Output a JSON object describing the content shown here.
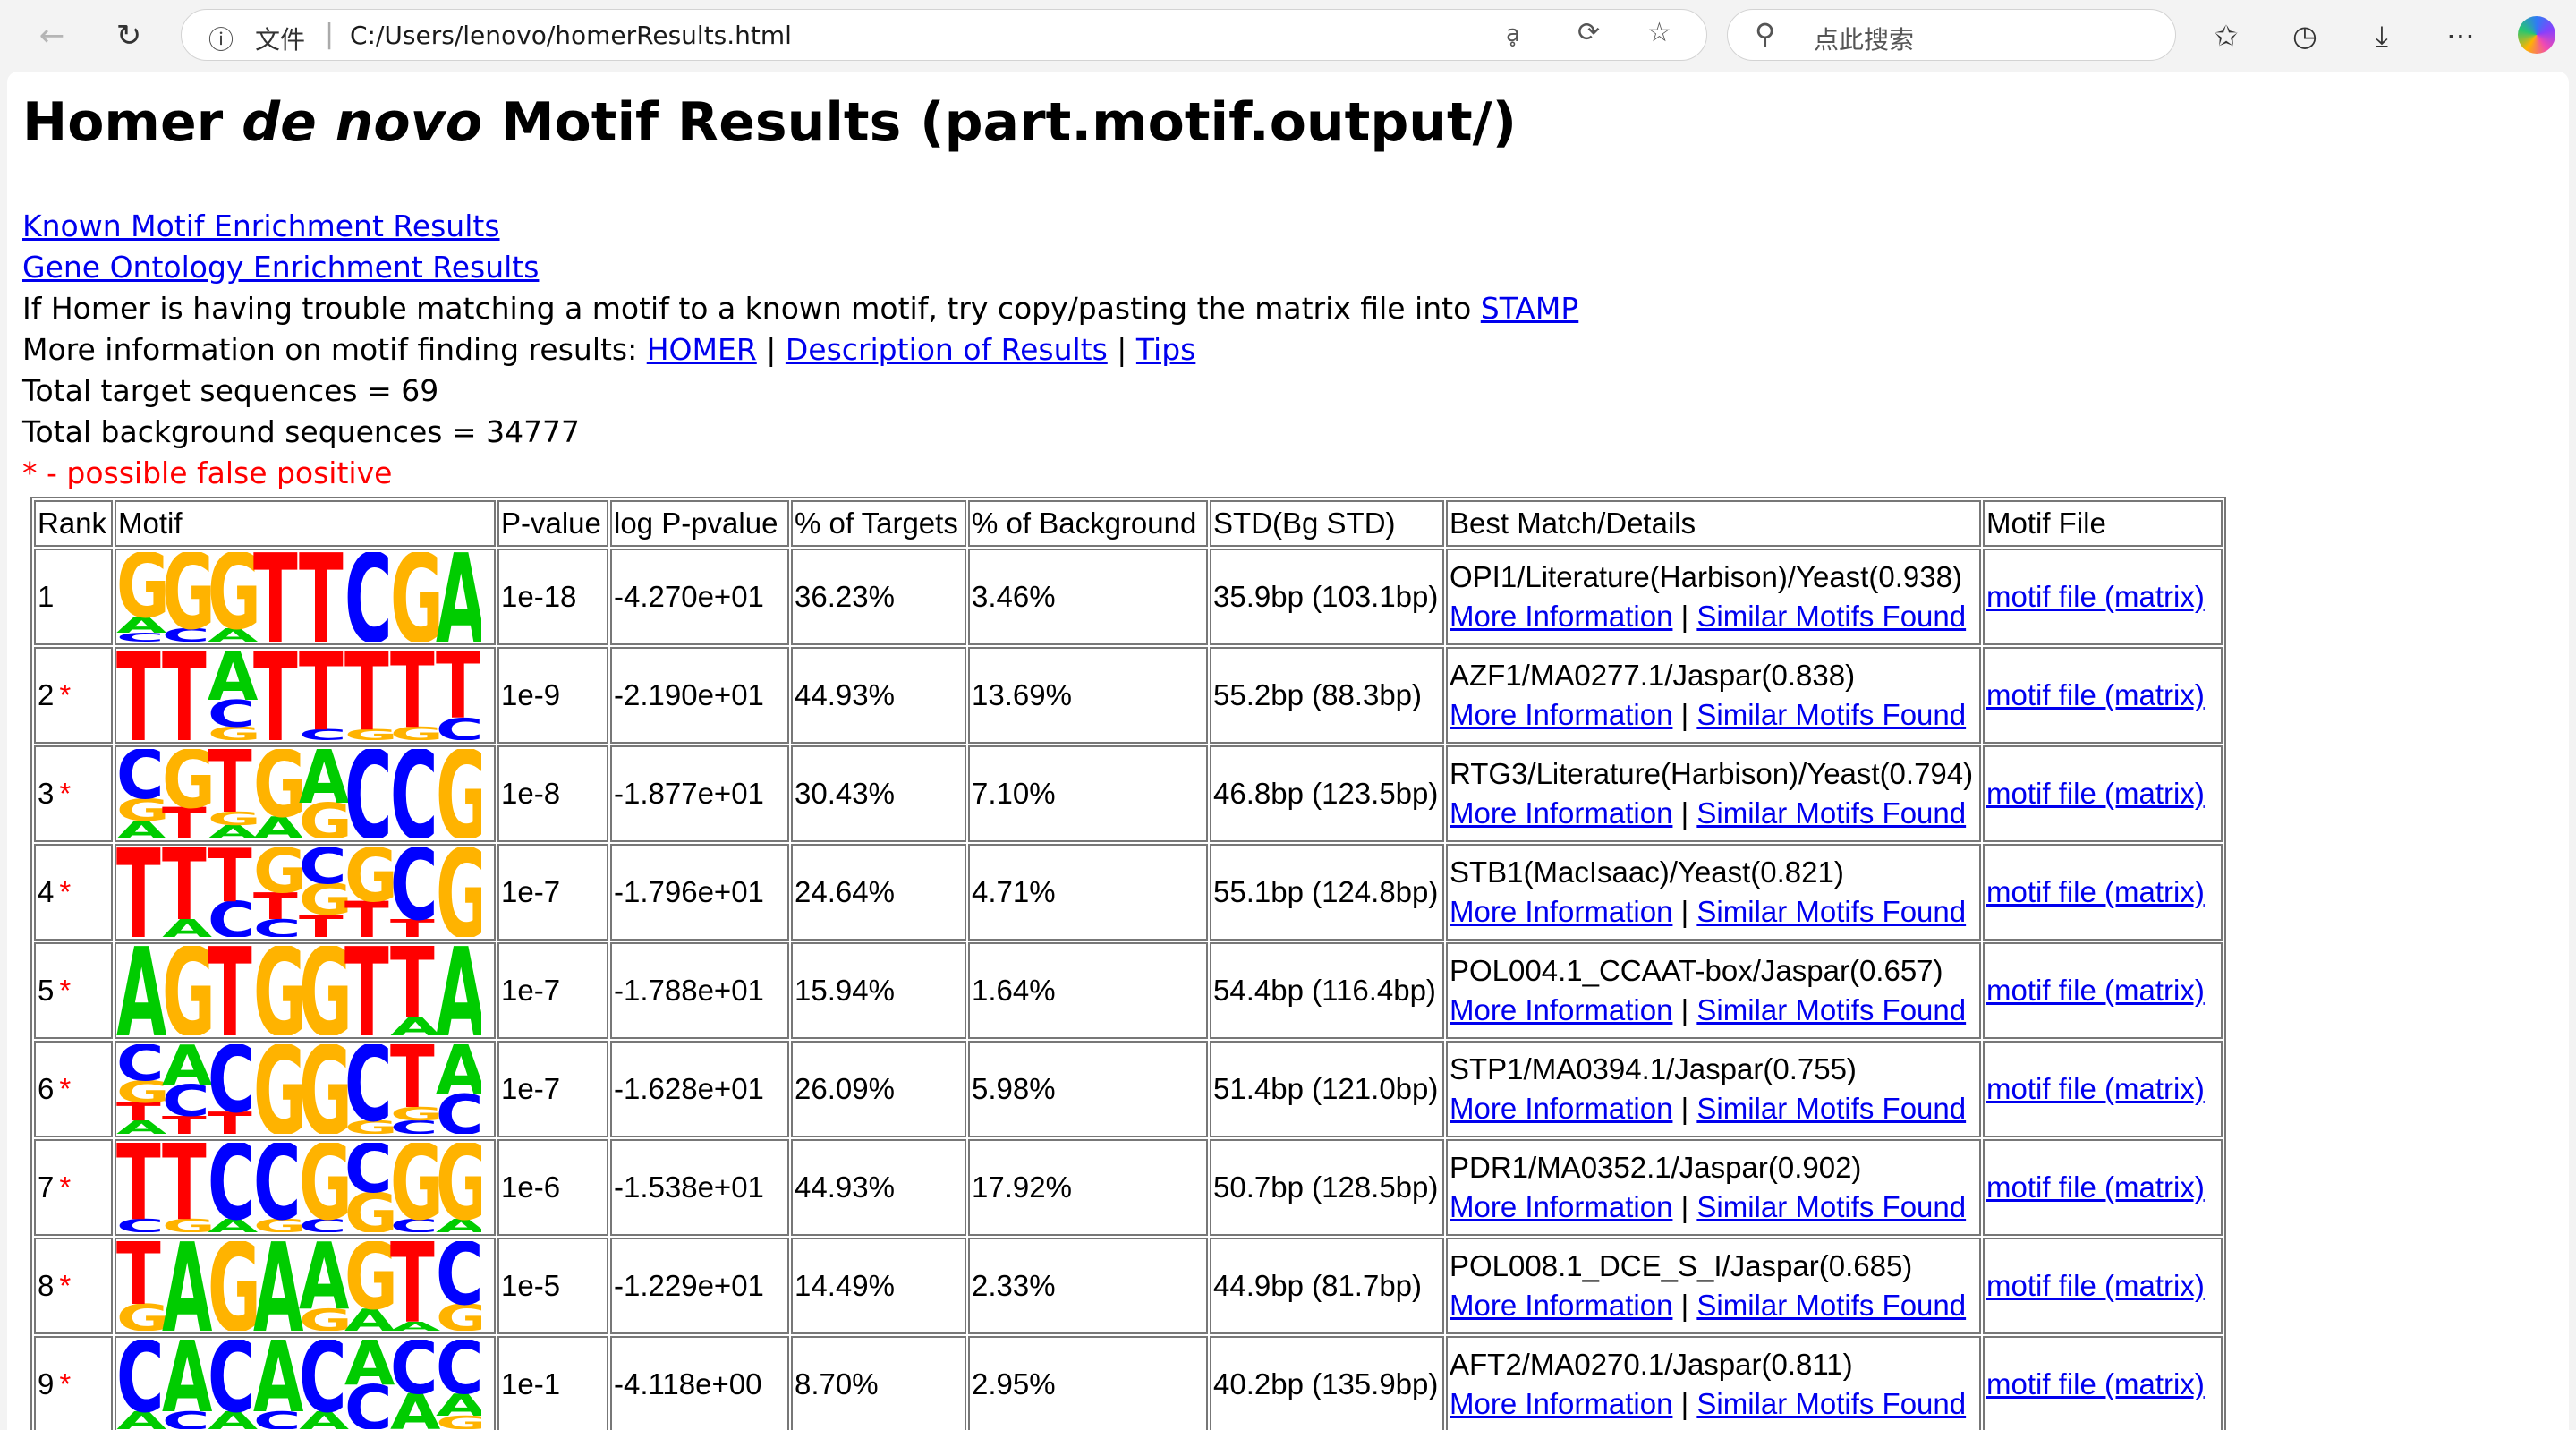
{
  "browser": {
    "address": {
      "info_icon": "info-icon",
      "file_label": "文件",
      "url": "C:/Users/lenovo/homerResults.html"
    },
    "search": {
      "placeholder": "点此搜索"
    },
    "icons": {
      "back": "back-arrow-icon",
      "refresh": "refresh-icon",
      "read_aloud": "read-aloud-icon",
      "extensions": "extensions-icon",
      "favorite": "star-icon",
      "favorites": "favorites-icon",
      "history": "history-icon",
      "downloads": "download-icon",
      "more": "more-icon",
      "copilot": "copilot-icon"
    }
  },
  "page": {
    "title_prefix": "Homer ",
    "title_italic": "de novo",
    "title_suffix": " Motif Results (part.motif.output/)",
    "link_known": "Known Motif Enrichment Results",
    "link_go": "Gene Ontology Enrichment Results",
    "stamp_text": "If Homer is having trouble matching a motif to a known motif, try copy/pasting the matrix file into ",
    "stamp_link": "STAMP",
    "more_info_text": "More information on motif finding results: ",
    "link_homer": "HOMER",
    "link_description": "Description of Results",
    "link_tips": "Tips",
    "separator": " | ",
    "total_target": "Total target sequences = 69",
    "total_background": "Total background sequences = 34777",
    "false_positive_note": "* - possible false positive"
  },
  "colors": {
    "A": "#00cc00",
    "C": "#0000ff",
    "G": "#ffb300",
    "T": "#ff0000",
    "link": "#0000ee",
    "warning": "#ff0000"
  },
  "table": {
    "headers": [
      "Rank",
      "Motif",
      "P-value",
      "log P-pvalue",
      "% of Targets",
      "% of Background",
      "STD(Bg STD)",
      "Best Match/Details",
      "Motif File"
    ],
    "more_info_label": "More Information",
    "similar_label": "Similar Motifs Found",
    "motif_file_label": "motif file (matrix)",
    "rows": [
      {
        "rank": "1",
        "star": "",
        "pvalue": "1e-18",
        "logp": "-4.270e+01",
        "targets": "36.23%",
        "background": "3.46%",
        "std": "35.9bp (103.1bp)",
        "match": "OPI1/Literature(Harbison)/Yeast(0.938)",
        "logo": [
          [
            {
              "b": "G",
              "h": 0.72
            },
            {
              "b": "C",
              "h": 0.1
            },
            {
              "b": "A",
              "h": 0.18
            }
          ],
          [
            {
              "b": "G",
              "h": 0.85
            },
            {
              "b": "C",
              "h": 0.15
            }
          ],
          [
            {
              "b": "G",
              "h": 0.85
            },
            {
              "b": "A",
              "h": 0.15
            }
          ],
          [
            {
              "b": "T",
              "h": 1.0
            }
          ],
          [
            {
              "b": "T",
              "h": 1.0
            }
          ],
          [
            {
              "b": "C",
              "h": 1.0
            }
          ],
          [
            {
              "b": "G",
              "h": 1.0
            }
          ],
          [
            {
              "b": "A",
              "h": 1.0
            }
          ]
        ]
      },
      {
        "rank": "2",
        "star": "*",
        "pvalue": "1e-9",
        "logp": "-2.190e+01",
        "targets": "44.93%",
        "background": "13.69%",
        "std": "55.2bp (88.3bp)",
        "match": "AZF1/MA0277.1/Jaspar(0.838)",
        "logo": [
          [
            {
              "b": "T",
              "h": 1.0
            }
          ],
          [
            {
              "b": "T",
              "h": 1.0
            }
          ],
          [
            {
              "b": "A",
              "h": 0.55
            },
            {
              "b": "C",
              "h": 0.3
            },
            {
              "b": "G",
              "h": 0.15
            }
          ],
          [
            {
              "b": "T",
              "h": 1.0
            }
          ],
          [
            {
              "b": "T",
              "h": 0.88
            },
            {
              "b": "C",
              "h": 0.12
            }
          ],
          [
            {
              "b": "T",
              "h": 0.88
            },
            {
              "b": "G",
              "h": 0.12
            }
          ],
          [
            {
              "b": "T",
              "h": 0.85
            },
            {
              "b": "G",
              "h": 0.15
            }
          ],
          [
            {
              "b": "T",
              "h": 0.75
            },
            {
              "b": "C",
              "h": 0.25
            }
          ]
        ]
      },
      {
        "rank": "3",
        "star": "*",
        "pvalue": "1e-8",
        "logp": "-1.877e+01",
        "targets": "30.43%",
        "background": "7.10%",
        "std": "46.8bp (123.5bp)",
        "match": "RTG3/Literature(Harbison)/Yeast(0.794)",
        "logo": [
          [
            {
              "b": "C",
              "h": 0.55
            },
            {
              "b": "G",
              "h": 0.25
            },
            {
              "b": "A",
              "h": 0.2
            }
          ],
          [
            {
              "b": "G",
              "h": 0.65
            },
            {
              "b": "T",
              "h": 0.35
            }
          ],
          [
            {
              "b": "T",
              "h": 0.7
            },
            {
              "b": "A",
              "h": 0.15
            },
            {
              "b": "G",
              "h": 0.15
            }
          ],
          [
            {
              "b": "G",
              "h": 0.75
            },
            {
              "b": "A",
              "h": 0.25
            }
          ],
          [
            {
              "b": "A",
              "h": 0.6
            },
            {
              "b": "G",
              "h": 0.4
            }
          ],
          [
            {
              "b": "C",
              "h": 1.0
            }
          ],
          [
            {
              "b": "C",
              "h": 1.0
            }
          ],
          [
            {
              "b": "G",
              "h": 1.0
            }
          ]
        ]
      },
      {
        "rank": "4",
        "star": "*",
        "pvalue": "1e-7",
        "logp": "-1.796e+01",
        "targets": "24.64%",
        "background": "4.71%",
        "std": "55.1bp (124.8bp)",
        "match": "STB1(MacIsaac)/Yeast(0.821)",
        "logo": [
          [
            {
              "b": "T",
              "h": 1.0
            }
          ],
          [
            {
              "b": "T",
              "h": 0.8
            },
            {
              "b": "A",
              "h": 0.2
            }
          ],
          [
            {
              "b": "T",
              "h": 0.6
            },
            {
              "b": "C",
              "h": 0.4
            }
          ],
          [
            {
              "b": "G",
              "h": 0.5
            },
            {
              "b": "T",
              "h": 0.3
            },
            {
              "b": "C",
              "h": 0.2
            }
          ],
          [
            {
              "b": "C",
              "h": 0.4
            },
            {
              "b": "G",
              "h": 0.35
            },
            {
              "b": "T",
              "h": 0.25
            }
          ],
          [
            {
              "b": "G",
              "h": 0.6
            },
            {
              "b": "T",
              "h": 0.4
            }
          ],
          [
            {
              "b": "C",
              "h": 0.8
            },
            {
              "b": "T",
              "h": 0.2
            }
          ],
          [
            {
              "b": "G",
              "h": 1.0
            }
          ]
        ]
      },
      {
        "rank": "5",
        "star": "*",
        "pvalue": "1e-7",
        "logp": "-1.788e+01",
        "targets": "15.94%",
        "background": "1.64%",
        "std": "54.4bp (116.4bp)",
        "match": "POL004.1_CCAAT-box/Jaspar(0.657)",
        "logo": [
          [
            {
              "b": "A",
              "h": 1.0
            }
          ],
          [
            {
              "b": "G",
              "h": 1.0
            }
          ],
          [
            {
              "b": "T",
              "h": 1.0
            }
          ],
          [
            {
              "b": "G",
              "h": 1.0
            }
          ],
          [
            {
              "b": "G",
              "h": 1.0
            }
          ],
          [
            {
              "b": "T",
              "h": 1.0
            }
          ],
          [
            {
              "b": "T",
              "h": 0.8
            },
            {
              "b": "A",
              "h": 0.2
            }
          ],
          [
            {
              "b": "A",
              "h": 1.0
            }
          ]
        ]
      },
      {
        "rank": "6",
        "star": "*",
        "pvalue": "1e-7",
        "logp": "-1.628e+01",
        "targets": "26.09%",
        "background": "5.98%",
        "std": "51.4bp (121.0bp)",
        "match": "STP1/MA0394.1/Jaspar(0.755)",
        "logo": [
          [
            {
              "b": "C",
              "h": 0.4
            },
            {
              "b": "G",
              "h": 0.25
            },
            {
              "b": "T",
              "h": 0.2
            },
            {
              "b": "A",
              "h": 0.15
            }
          ],
          [
            {
              "b": "A",
              "h": 0.45
            },
            {
              "b": "C",
              "h": 0.35
            },
            {
              "b": "T",
              "h": 0.2
            }
          ],
          [
            {
              "b": "C",
              "h": 0.75
            },
            {
              "b": "T",
              "h": 0.25
            }
          ],
          [
            {
              "b": "G",
              "h": 1.0
            }
          ],
          [
            {
              "b": "G",
              "h": 1.0
            }
          ],
          [
            {
              "b": "C",
              "h": 0.85
            },
            {
              "b": "G",
              "h": 0.15
            }
          ],
          [
            {
              "b": "T",
              "h": 0.7
            },
            {
              "b": "C",
              "h": 0.15
            },
            {
              "b": "G",
              "h": 0.15
            }
          ],
          [
            {
              "b": "A",
              "h": 0.55
            },
            {
              "b": "C",
              "h": 0.45
            }
          ]
        ]
      },
      {
        "rank": "7",
        "star": "*",
        "pvalue": "1e-6",
        "logp": "-1.538e+01",
        "targets": "44.93%",
        "background": "17.92%",
        "std": "50.7bp (128.5bp)",
        "match": "PDR1/MA0352.1/Jaspar(0.902)",
        "logo": [
          [
            {
              "b": "T",
              "h": 0.85
            },
            {
              "b": "C",
              "h": 0.15
            }
          ],
          [
            {
              "b": "T",
              "h": 0.85
            },
            {
              "b": "G",
              "h": 0.15
            }
          ],
          [
            {
              "b": "C",
              "h": 0.85
            },
            {
              "b": "A",
              "h": 0.15
            }
          ],
          [
            {
              "b": "C",
              "h": 0.85
            },
            {
              "b": "G",
              "h": 0.15
            }
          ],
          [
            {
              "b": "G",
              "h": 0.85
            },
            {
              "b": "C",
              "h": 0.15
            }
          ],
          [
            {
              "b": "C",
              "h": 0.55
            },
            {
              "b": "G",
              "h": 0.45
            }
          ],
          [
            {
              "b": "G",
              "h": 0.85
            },
            {
              "b": "C",
              "h": 0.15
            }
          ],
          [
            {
              "b": "G",
              "h": 0.85
            },
            {
              "b": "A",
              "h": 0.15
            }
          ]
        ]
      },
      {
        "rank": "8",
        "star": "*",
        "pvalue": "1e-5",
        "logp": "-1.229e+01",
        "targets": "14.49%",
        "background": "2.33%",
        "std": "44.9bp (81.7bp)",
        "match": "POL008.1_DCE_S_I/Jaspar(0.685)",
        "logo": [
          [
            {
              "b": "T",
              "h": 0.7
            },
            {
              "b": "G",
              "h": 0.3
            }
          ],
          [
            {
              "b": "A",
              "h": 1.0
            }
          ],
          [
            {
              "b": "G",
              "h": 1.0
            }
          ],
          [
            {
              "b": "A",
              "h": 1.0
            }
          ],
          [
            {
              "b": "A",
              "h": 0.75
            },
            {
              "b": "G",
              "h": 0.25
            }
          ],
          [
            {
              "b": "G",
              "h": 0.75
            },
            {
              "b": "A",
              "h": 0.25
            }
          ],
          [
            {
              "b": "T",
              "h": 0.9
            },
            {
              "b": "A",
              "h": 0.1
            }
          ],
          [
            {
              "b": "C",
              "h": 0.7
            },
            {
              "b": "G",
              "h": 0.3
            }
          ]
        ]
      },
      {
        "rank": "9",
        "star": "*",
        "pvalue": "1e-1",
        "logp": "-4.118e+00",
        "targets": "8.70%",
        "background": "2.95%",
        "std": "40.2bp (135.9bp)",
        "match": "AFT2/MA0270.1/Jaspar(0.811)",
        "logo": [
          [
            {
              "b": "C",
              "h": 0.8
            },
            {
              "b": "A",
              "h": 0.2
            }
          ],
          [
            {
              "b": "A",
              "h": 0.8
            },
            {
              "b": "C",
              "h": 0.2
            }
          ],
          [
            {
              "b": "C",
              "h": 0.8
            },
            {
              "b": "A",
              "h": 0.2
            }
          ],
          [
            {
              "b": "A",
              "h": 0.8
            },
            {
              "b": "C",
              "h": 0.2
            }
          ],
          [
            {
              "b": "C",
              "h": 0.8
            },
            {
              "b": "A",
              "h": 0.2
            }
          ],
          [
            {
              "b": "C",
              "h": 0.5
            },
            {
              "b": "A",
              "h": 0.5
            }
          ],
          [
            {
              "b": "C",
              "h": 0.6
            },
            {
              "b": "A",
              "h": 0.4
            }
          ],
          [
            {
              "b": "C",
              "h": 0.6
            },
            {
              "b": "A",
              "h": 0.25
            },
            {
              "b": "G",
              "h": 0.15
            }
          ]
        ]
      }
    ]
  }
}
